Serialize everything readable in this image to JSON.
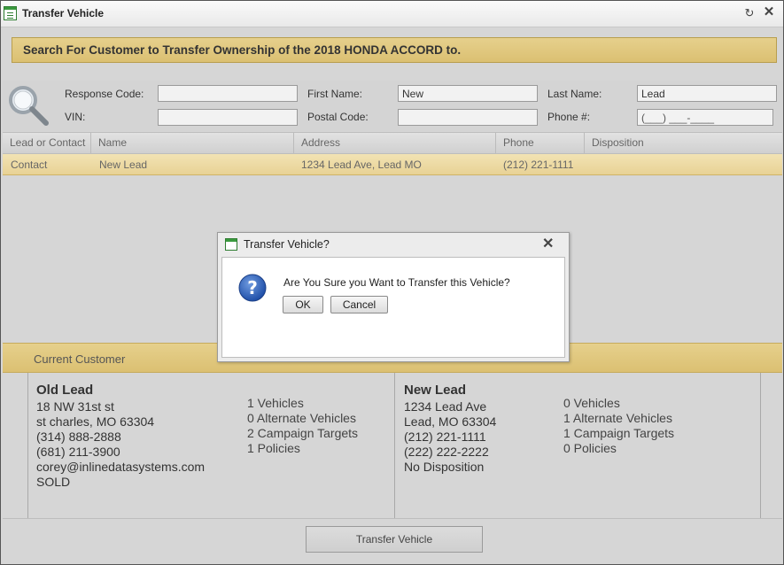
{
  "window": {
    "title": "Transfer Vehicle"
  },
  "banner": {
    "text": "Search For Customer to Transfer Ownership of the 2018 HONDA ACCORD to."
  },
  "search": {
    "response_code_label": "Response Code:",
    "response_code_value": "",
    "vin_label": "VIN:",
    "vin_value": "",
    "first_name_label": "First Name:",
    "first_name_value": "New",
    "postal_code_label": "Postal Code:",
    "postal_code_value": "",
    "last_name_label": "Last Name:",
    "last_name_value": "Lead",
    "phone_label": "Phone #:",
    "phone_placeholder": "(___) ___-____"
  },
  "grid": {
    "columns": [
      "Lead or Contact",
      "Name",
      "Address",
      "Phone",
      "Disposition"
    ],
    "rows": [
      [
        "Contact",
        "New Lead",
        "1234 Lead Ave, Lead MO",
        "(212) 221-1111",
        ""
      ]
    ]
  },
  "current_customer": {
    "header": "Current Customer",
    "old": {
      "name": "Old Lead",
      "lines": [
        "18 NW 31st st",
        "st charles, MO 63304",
        "(314) 888-2888",
        "(681) 211-3900",
        "corey@inlinedatasystems.com",
        "SOLD"
      ],
      "stats": [
        "1 Vehicles",
        "0 Alternate Vehicles",
        "2 Campaign Targets",
        "1 Policies"
      ]
    },
    "new": {
      "name": "New Lead",
      "lines": [
        "1234 Lead Ave",
        "Lead, MO 63304",
        "(212) 221-1111",
        "(222) 222-2222",
        "No Disposition"
      ],
      "stats": [
        "0 Vehicles",
        "1 Alternate Vehicles",
        "1 Campaign Targets",
        "0 Policies"
      ]
    }
  },
  "footer": {
    "transfer_button": "Transfer Vehicle"
  },
  "dialog": {
    "title": "Transfer Vehicle?",
    "message": "Are You Sure you Want to Transfer this Vehicle?",
    "ok_label": "OK",
    "cancel_label": "Cancel"
  },
  "colors": {
    "accent_gold": "#dbc072",
    "selected_row": "#ecd89e",
    "window_bg": "#d6d6d6"
  },
  "icons": [
    "app-icon",
    "refresh-icon",
    "close-icon",
    "magnifier-icon",
    "question-icon"
  ]
}
